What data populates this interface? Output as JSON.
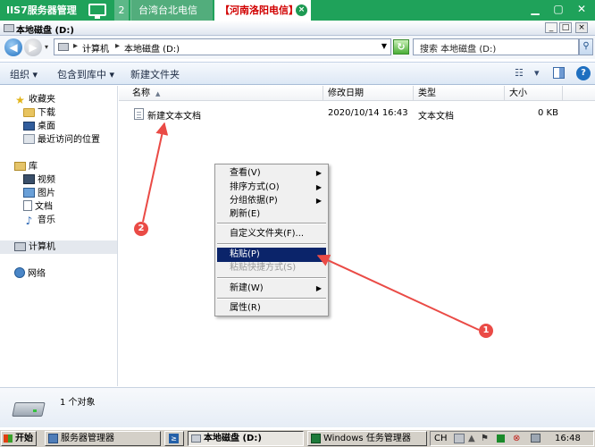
{
  "session_tabs": {
    "main": "IIS7服务器管理",
    "count": "2",
    "tab_taiwan": "台湾台北电信",
    "tab_active": "【河南洛阳电信】",
    "minimize": "▁",
    "restore": "▢",
    "close": "✕"
  },
  "window": {
    "title": "本地磁盘 (D:)",
    "controls": [
      "_",
      "□",
      "×"
    ]
  },
  "address": {
    "segments": [
      "计算机",
      "本地磁盘 (D:)"
    ],
    "search_placeholder": "搜索 本地磁盘 (D:)"
  },
  "toolbar": {
    "organize": "组织 ▾",
    "include_library": "包含到库中 ▾",
    "new_folder": "新建文件夹",
    "view_icon": "☷",
    "view_drop": "▾",
    "help": "?"
  },
  "nav": {
    "favorites": "收藏夹",
    "favorites_items": [
      "下载",
      "桌面",
      "最近访问的位置"
    ],
    "libraries": "库",
    "library_items": [
      "视频",
      "图片",
      "文档",
      "音乐"
    ],
    "computer": "计算机",
    "network": "网络"
  },
  "columns": [
    "名称",
    "修改日期",
    "类型",
    "大小"
  ],
  "files": [
    {
      "name": "新建文本文档",
      "modified": "2020/10/14 16:43",
      "type": "文本文档",
      "size": "0 KB"
    }
  ],
  "context_menu": {
    "view": "查看(V)",
    "sort": "排序方式(O)",
    "group": "分组依据(P)",
    "refresh": "刷新(E)",
    "customize": "自定义文件夹(F)...",
    "paste": "粘贴(P)",
    "paste_shortcut": "粘贴快捷方式(S)",
    "new": "新建(W)",
    "properties": "属性(R)"
  },
  "annotations": {
    "badge1": "1",
    "badge2": "2",
    "color": "#ea4b46"
  },
  "status": {
    "count": "1 个对象"
  },
  "taskbar": {
    "start": "开始",
    "server_manager": "服务器管理器",
    "local_disk": "本地磁盘 (D:)",
    "task_manager": "Windows 任务管理器",
    "lang": "CH",
    "time": "16:48"
  }
}
